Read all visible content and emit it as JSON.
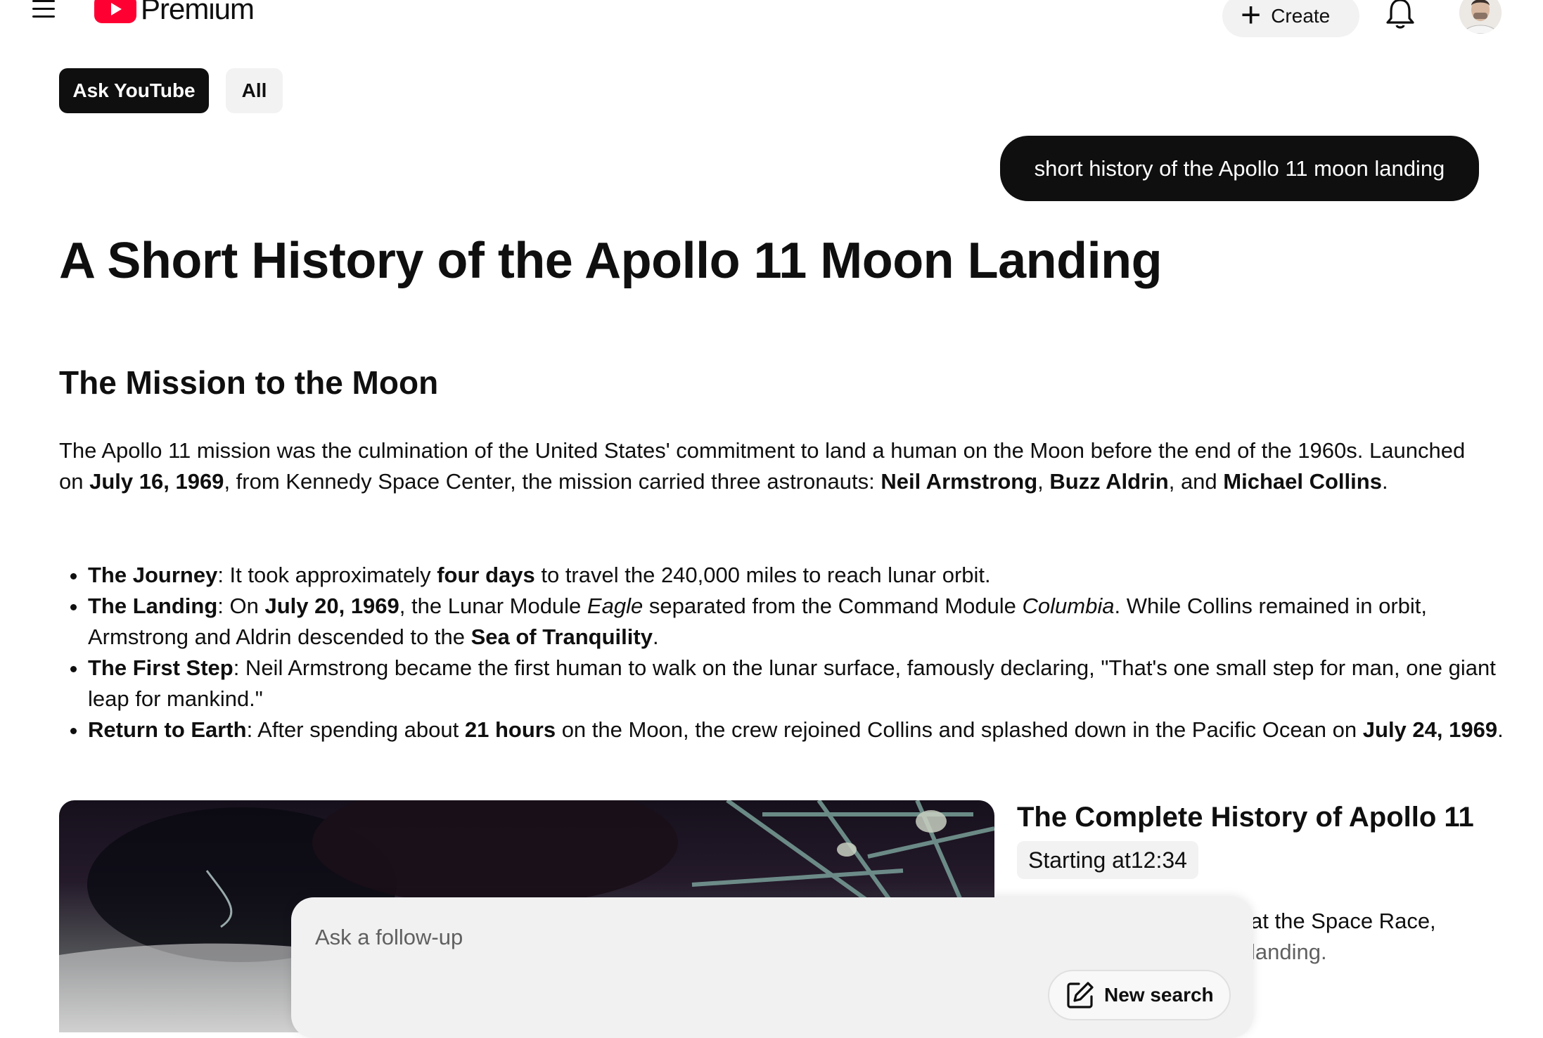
{
  "header": {
    "brand": "Premium",
    "create_label": "Create",
    "icons": {
      "menu": "hamburger-menu-icon",
      "bell": "notifications-bell-icon",
      "plus": "plus-icon",
      "logo": "youtube-play-icon"
    }
  },
  "chips": [
    {
      "label": "Ask YouTube",
      "active": true
    },
    {
      "label": "All",
      "active": false
    }
  ],
  "query": "short history of the Apollo 11 moon landing",
  "article": {
    "title": "A Short History of the Apollo 11 Moon Landing",
    "section_title": "The Mission to the Moon",
    "intro": {
      "p1": "The Apollo 11 mission was the culmination of the United States' commitment to land a human on the Moon before the end of the 1960s. Launched on ",
      "date_launch": "July 16, 1969",
      "p2": ", from Kennedy Space Center, the mission carried three astronauts: ",
      "name1": "Neil Armstrong",
      "sep1": ", ",
      "name2": "Buzz Aldrin",
      "sep2": ", and ",
      "name3": "Michael Collins",
      "end": "."
    },
    "bullets": {
      "journey": {
        "label": "The Journey",
        "t1": ": It took approximately ",
        "b1": "four days",
        "t2": " to travel the 240,000 miles to reach lunar orbit."
      },
      "landing": {
        "label": "The Landing",
        "t1": ": On ",
        "b1": "July 20, 1969",
        "t2": ", the Lunar Module ",
        "i1": "Eagle",
        "t3": " separated from the Command Module ",
        "i2": "Columbia",
        "t4": ". While Collins remained in orbit, Armstrong and Aldrin descended to the ",
        "b2": "Sea of Tranquility",
        "t5": "."
      },
      "first_step": {
        "label": "The First Step",
        "t1": ": Neil Armstrong became the first human to walk on the lunar surface, famously declaring, \"That's one small step for man, one giant leap for mankind.\""
      },
      "return": {
        "label": "Return to Earth",
        "t1": ": After spending about ",
        "b1": "21 hours",
        "t2": " on the Moon, the crew rejoined Collins and splashed down in the Pacific Ocean on ",
        "b2": "July 24, 1969",
        "t3": "."
      }
    }
  },
  "video": {
    "title": "The Complete History of Apollo 11",
    "starting_label": "Starting at ",
    "timestamp": "12:34",
    "desc_line1": "at the Space Race,",
    "desc_line2": "landing."
  },
  "followup": {
    "placeholder": "Ask a follow-up",
    "new_search_label": "New search",
    "icon": "edit-pencil-icon"
  }
}
